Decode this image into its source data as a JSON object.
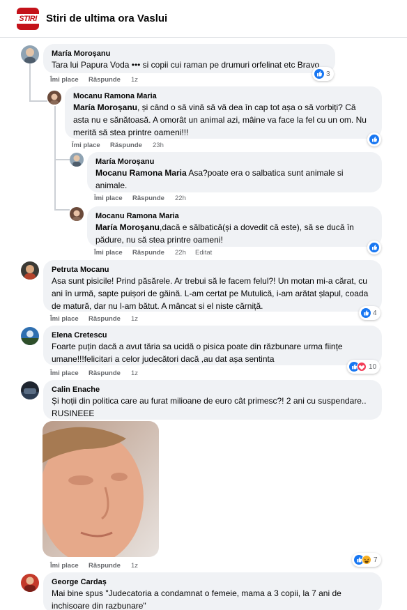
{
  "page": {
    "title": "Stiri de ultima ora Vaslui",
    "logo_text": "STIRI"
  },
  "colors": {
    "accent": "#1877f2",
    "bubble": "#f0f2f5",
    "meta": "#65676b",
    "logo": "#c4121a"
  },
  "comments": [
    {
      "author": "María Moroșanu",
      "text": "Tara lui Papura Voda ••• si copii cui raman pe drumuri orfelinat etc Bravo",
      "like": "Îmi place",
      "reply": "Răspunde",
      "time": "1z",
      "reactions": {
        "icons": [
          "like-icon"
        ],
        "count": "3"
      }
    },
    {
      "author": "Mocanu Ramona Maria",
      "mention": "María Moroșanu",
      "text": ", și când o să vină să vă dea în cap tot așa o să vorbiți? Că asta nu e sănătoasă. A omorât un animal azi, mâine va face la fel cu un om. Nu merită să stea printre oameni!!!",
      "like": "Îmi place",
      "reply": "Răspunde",
      "time": "23h",
      "reactions": {
        "icons": [
          "like-icon"
        ],
        "count": ""
      }
    },
    {
      "author": "María Moroșanu",
      "mention": "Mocanu Ramona Maria",
      "text": " Asa?poate era o salbatica sunt animale si animale.",
      "like": "Îmi place",
      "reply": "Răspunde",
      "time": "22h"
    },
    {
      "author": "Mocanu Ramona Maria",
      "mention": "María Moroșanu",
      "text": ",dacă e sălbatică(și a dovedit că este), să se ducă în pădure, nu să stea printre oameni!",
      "like": "Îmi place",
      "reply": "Răspunde",
      "time": "22h",
      "edited": "Editat",
      "reactions": {
        "icons": [
          "like-icon"
        ],
        "count": ""
      }
    },
    {
      "author": "Petruta Mocanu",
      "text": "Asa sunt pisicile! Prind păsărele. Ar trebui să le facem felul?! Un motan mi-a cărat, cu ani în urmă, sapte puișori de găină. L-am certat pe Mutulică, i-am arătat șlapul, coada de matură, dar nu l-am bătut. A mâncat si el niste cărniță.",
      "like": "Îmi place",
      "reply": "Răspunde",
      "time": "1z",
      "reactions": {
        "icons": [
          "like-icon"
        ],
        "count": "4"
      }
    },
    {
      "author": "Elena Cretescu",
      "text": "Foarte puțin dacă a avut tăria sa ucidă o pisica poate din răzbunare urma ființe umane!!!felicitari a celor judecători dacă ,au dat așa sentinta",
      "like": "Îmi place",
      "reply": "Răspunde",
      "time": "1z",
      "reactions": {
        "icons": [
          "like-icon",
          "love-icon"
        ],
        "count": "10"
      }
    },
    {
      "author": "Calin Enache",
      "text": "Și hoții din politica care au furat milioane de euro cât primesc?! 2 ani cu suspendare.. RUSINEEE",
      "like": "Îmi place",
      "reply": "Răspunde",
      "time": "1z",
      "reactions": {
        "icons": [
          "like-icon",
          "haha-icon"
        ],
        "count": "7"
      }
    },
    {
      "author": "George Cardaș",
      "text": "Mai bine spus \"Judecatoria a condamnat o femeie, mama a 3 copii, la 7 ani de inchisoare din razbunare\""
    }
  ]
}
